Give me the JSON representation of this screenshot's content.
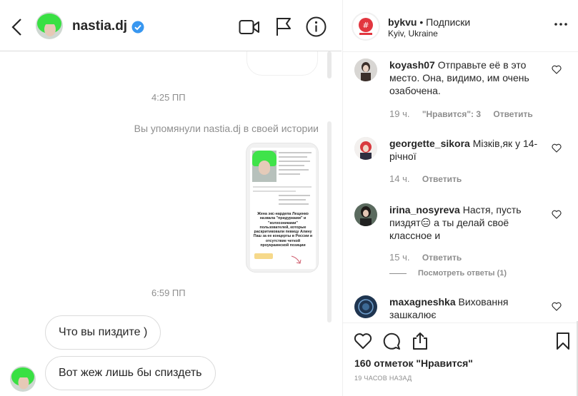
{
  "dm": {
    "username": "nastia.dj",
    "timestamps": [
      "4:25 ПП",
      "6:59 ПП"
    ],
    "mention_notice": "Вы упомянули nastia.dj в своей истории",
    "story": {
      "caption": "Жена экс-нардепа Лещенко назвала \"придурками\" и \"колхозниками\" пользователей, которые раскритиковали певицу Алину Паш за ее концерты в России и отсутствие четкой проукраинской позиции",
      "tag": "@ALINAPASH"
    },
    "messages": [
      "Что вы пиздите )",
      "Вот жеж лишь бы спиздеть"
    ]
  },
  "post": {
    "account": "bykvu",
    "follow_label": "Подписки",
    "location": "Kyiv, Ukraine",
    "comments": [
      {
        "user": "koyash07",
        "text": "Отправьте её в это место. Она, видимо, им очень озабочена.",
        "time": "19 ч.",
        "likes_label": "\"Нравится\": 3",
        "reply": "Ответить"
      },
      {
        "user": "georgette_sikora",
        "text": "Мізків,як у 14-річної",
        "time": "14 ч.",
        "reply": "Ответить"
      },
      {
        "user": "irina_nosyreva",
        "text": "Настя, пусть пиздят😑 а ты делай своё классное и",
        "time": "15 ч.",
        "reply": "Ответить",
        "view_replies": "Посмотреть ответы (1)"
      },
      {
        "user": "maxagneshka",
        "text": "Виховання зашкалює"
      }
    ],
    "likes": "160 отметок \"Нравится\"",
    "age": "19 ЧАСОВ НАЗАД"
  },
  "icons": [
    "back-icon",
    "verified-icon",
    "video-call-icon",
    "report-flag-icon",
    "info-icon",
    "more-icon",
    "heart-icon",
    "comment-icon",
    "share-icon",
    "bookmark-icon"
  ],
  "colors": {
    "verified": "#3897f0",
    "text": "#262626",
    "muted": "#8e8e8e",
    "border": "#dbdbdb"
  }
}
